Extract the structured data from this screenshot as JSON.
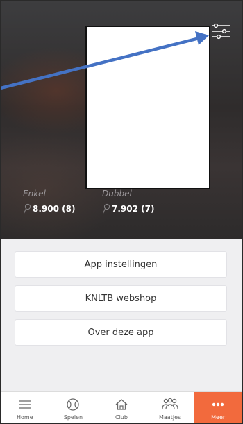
{
  "colors": {
    "accent": "#f26a3d",
    "annotation_arrow": "#4472c4",
    "hero_background": "#333031",
    "menu_background": "#efeff1"
  },
  "header": {
    "filter_icon": "sliders-icon"
  },
  "ratings": [
    {
      "label": "Enkel",
      "value": "8.900 (8)",
      "icon": "pin-icon"
    },
    {
      "label": "Dubbel",
      "value": "7.902 (7)",
      "icon": "pin-icon"
    }
  ],
  "menu": {
    "items": [
      {
        "label": "App instellingen"
      },
      {
        "label": "KNLTB webshop"
      },
      {
        "label": "Over deze app"
      }
    ]
  },
  "tabbar": {
    "active": "Meer",
    "items": [
      {
        "label": "Home",
        "icon": "menu-lines-icon"
      },
      {
        "label": "Spelen",
        "icon": "tennis-ball-icon"
      },
      {
        "label": "Club",
        "icon": "house-icon"
      },
      {
        "label": "Maatjes",
        "icon": "people-icon"
      },
      {
        "label": "Meer",
        "icon": "more-dots-icon"
      }
    ]
  }
}
